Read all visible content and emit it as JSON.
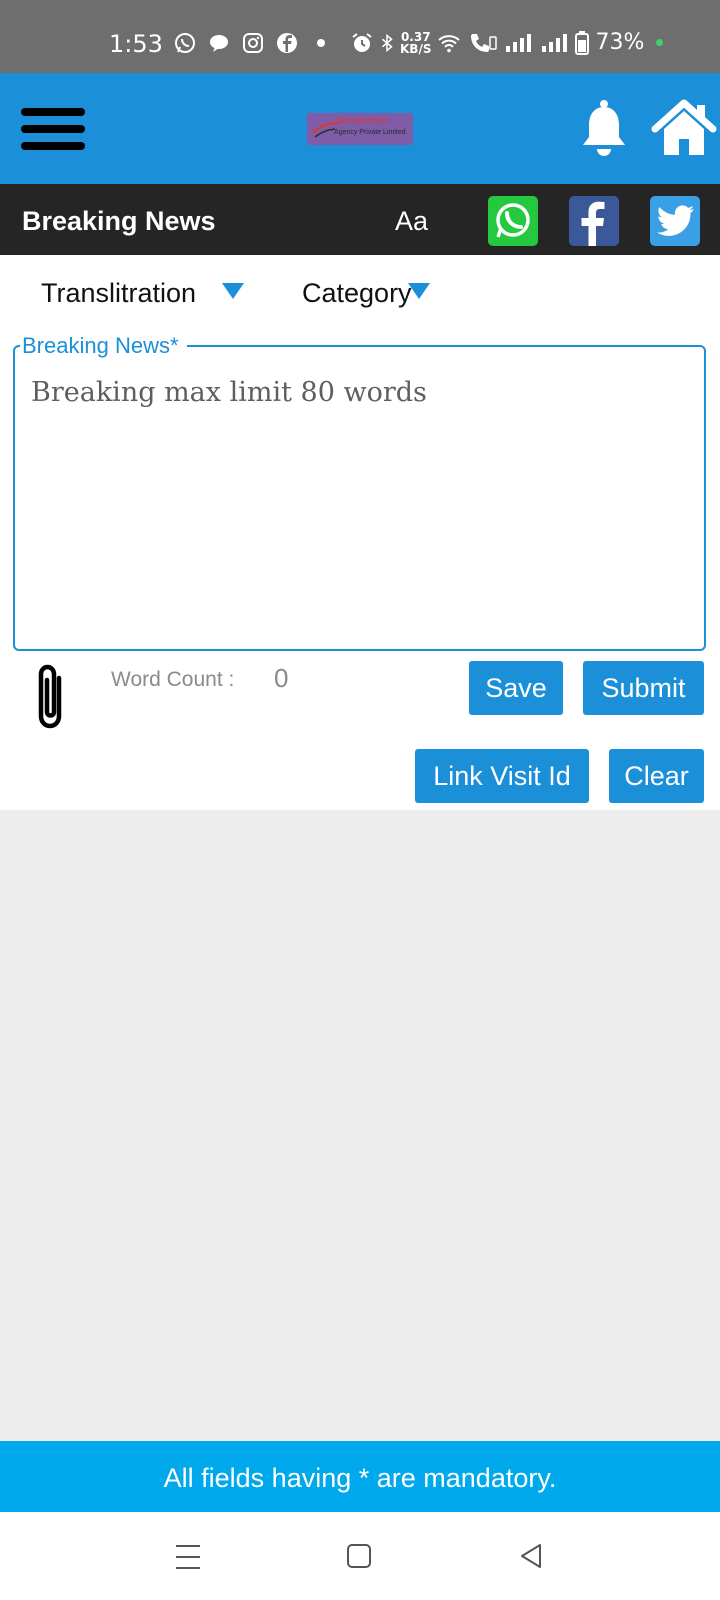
{
  "status_bar": {
    "time": "1:53",
    "speed_value": "0.37",
    "speed_unit": "KB/S",
    "battery": "73%",
    "icons": [
      "whatsapp-icon",
      "chat-icon",
      "instagram-icon",
      "facebook-icon",
      "dot-icon",
      "alarm-icon",
      "bluetooth-icon",
      "wifi-icon",
      "call-icon",
      "signal-icon",
      "signal-icon",
      "battery-icon"
    ]
  },
  "header": {
    "logo_line1": "Samvad News",
    "logo_line2": "Agency Private Limited",
    "icons": [
      "menu-icon",
      "bell-icon",
      "home-icon"
    ]
  },
  "title_bar": {
    "title": "Breaking News",
    "font_toggle": "Aa",
    "share_icons": [
      "whatsapp-icon",
      "facebook-icon",
      "twitter-icon"
    ]
  },
  "form": {
    "transliteration_label": "Translitration",
    "category_label": "Category",
    "field_legend": "Breaking News*",
    "textarea_placeholder": "Breaking max limit 80 words",
    "textarea_value": "",
    "word_count_label": "Word Count :",
    "word_count_value": "0",
    "buttons": {
      "save": "Save",
      "submit": "Submit",
      "link_visit": "Link Visit Id",
      "clear": "Clear"
    }
  },
  "footer": {
    "notice": "All fields having * are mandatory."
  },
  "colors": {
    "primary": "#1b8fd8",
    "title_bar": "#252525",
    "footer": "#00a8ec",
    "status_bar": "#6e6e6e"
  }
}
